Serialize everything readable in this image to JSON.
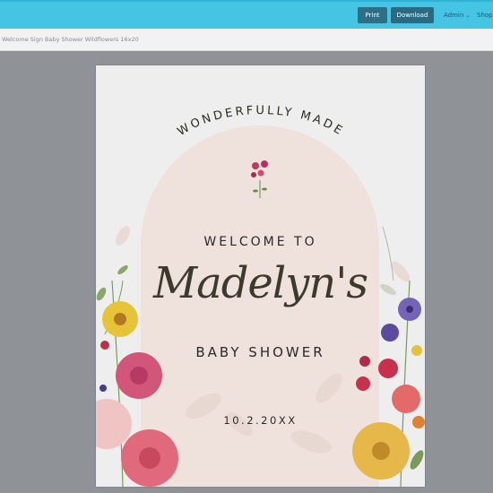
{
  "toolbar": {
    "print_label": "Print",
    "download_label": "Download",
    "admin_label": "Admin",
    "shop_label": "Shop"
  },
  "document": {
    "title": "Welcome Sign Baby Shower Wildflowers 16x20"
  },
  "sign": {
    "header": "WONDERFULLY MADE",
    "welcome": "WELCOME TO",
    "name": "Madelyn's",
    "event": "BABY SHOWER",
    "date": "10.2.20XX"
  },
  "colors": {
    "topbar": "#46c4e4",
    "button": "#2f6f86",
    "canvas": "#8f9398",
    "arch": "#efe1dc",
    "text": "#2b2a22"
  },
  "icons": {
    "admin_menu": "chevron-down-icon"
  }
}
